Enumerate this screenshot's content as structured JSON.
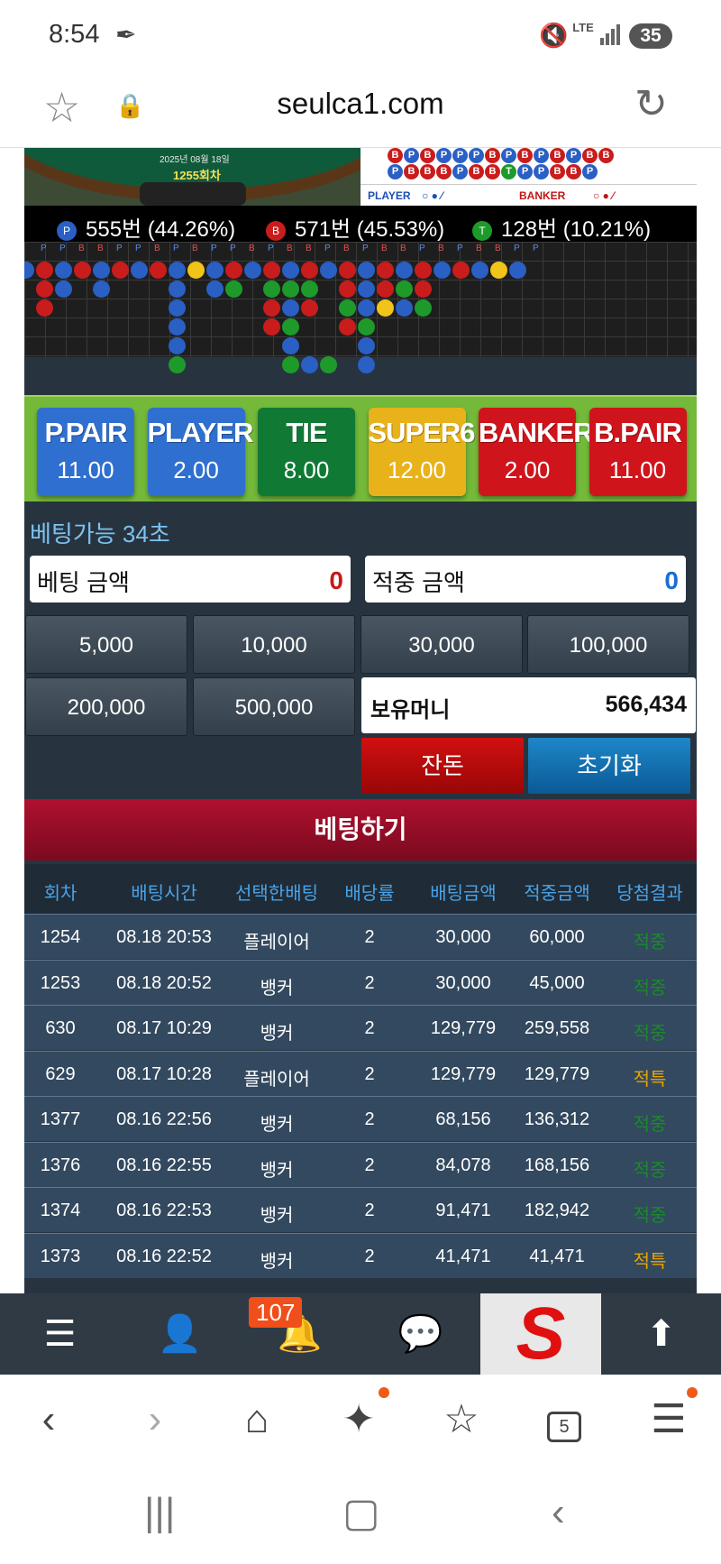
{
  "status_bar": {
    "time": "8:54",
    "network": "LTE",
    "battery": "35"
  },
  "browser": {
    "domain": "seulca1.com"
  },
  "game": {
    "date": "2025년 08월 18일",
    "round": "1255회차",
    "road_top_row1": [
      "B",
      "P",
      "B",
      "P",
      "P",
      "P",
      "B",
      "P",
      "B",
      "P",
      "B",
      "P",
      "B",
      "B"
    ],
    "road_top_row2": [
      "P",
      "B",
      "B",
      "B",
      "P",
      "B",
      "B",
      "T",
      "P",
      "P",
      "B",
      "B",
      "P"
    ],
    "legend_player": "PLAYER",
    "legend_banker": "BANKER",
    "stats": {
      "player": "555번 (44.26%)",
      "banker": "571번 (45.53%)",
      "tie": "128번 (10.21%)",
      "player_mark": "P",
      "banker_mark": "B",
      "tie_mark": "T"
    },
    "big_road_header": [
      "P",
      "P",
      "B",
      "B",
      "P",
      "P",
      "B",
      "P",
      "B",
      "P",
      "P",
      "B",
      "P",
      "B",
      "B",
      "P",
      "B",
      "P",
      "B",
      "B",
      "P",
      "B",
      "P",
      "B",
      "B",
      "P",
      "P"
    ]
  },
  "bet_options": [
    {
      "name": "P.PAIR",
      "odds": "11.00",
      "color": "#2f6fcf"
    },
    {
      "name": "PLAYER",
      "odds": "2.00",
      "color": "#2f6fcf"
    },
    {
      "name": "TIE",
      "odds": "8.00",
      "color": "#107a35"
    },
    {
      "name": "SUPER6",
      "odds": "12.00",
      "color": "#e8b21a"
    },
    {
      "name": "BANKER",
      "odds": "2.00",
      "color": "#d0141c"
    },
    {
      "name": "B.PAIR",
      "odds": "11.00",
      "color": "#d0141c"
    }
  ],
  "betting": {
    "time_label": "베팅가능 34초",
    "bet_amount_label": "베팅 금액",
    "bet_amount_value": "0",
    "win_amount_label": "적중 금액",
    "win_amount_value": "0",
    "chips": [
      "5,000",
      "10,000",
      "30,000",
      "100,000",
      "200,000",
      "500,000"
    ],
    "balance_label": "보유머니",
    "balance_value": "566,434",
    "change_button": "잔돈",
    "reset_button": "초기화",
    "submit_button": "베팅하기"
  },
  "history": {
    "headers": [
      "회차",
      "배팅시간",
      "선택한배팅",
      "배당률",
      "배팅금액",
      "적중금액",
      "당첨결과"
    ],
    "rows": [
      {
        "round": "1254",
        "time": "08.18 20:53",
        "choice": "플레이어",
        "odds": "2",
        "bet": "30,000",
        "win": "60,000",
        "result": "적중"
      },
      {
        "round": "1253",
        "time": "08.18 20:52",
        "choice": "뱅커",
        "odds": "2",
        "bet": "30,000",
        "win": "45,000",
        "result": "적중"
      },
      {
        "round": "630",
        "time": "08.17 10:29",
        "choice": "뱅커",
        "odds": "2",
        "bet": "129,779",
        "win": "259,558",
        "result": "적중"
      },
      {
        "round": "629",
        "time": "08.17 10:28",
        "choice": "플레이어",
        "odds": "2",
        "bet": "129,779",
        "win": "129,779",
        "result": "적특"
      },
      {
        "round": "1377",
        "time": "08.16 22:56",
        "choice": "뱅커",
        "odds": "2",
        "bet": "68,156",
        "win": "136,312",
        "result": "적중"
      },
      {
        "round": "1376",
        "time": "08.16 22:55",
        "choice": "뱅커",
        "odds": "2",
        "bet": "84,078",
        "win": "168,156",
        "result": "적중"
      },
      {
        "round": "1374",
        "time": "08.16 22:53",
        "choice": "뱅커",
        "odds": "2",
        "bet": "91,471",
        "win": "182,942",
        "result": "적중"
      },
      {
        "round": "1373",
        "time": "08.16 22:52",
        "choice": "뱅커",
        "odds": "2",
        "bet": "41,471",
        "win": "41,471",
        "result": "적특"
      }
    ]
  },
  "site_nav": {
    "notification_count": "107",
    "logo_letter": "S"
  },
  "browser_toolbar": {
    "tab_count": "5"
  },
  "colors": {
    "player": "#2a5fc4",
    "banker": "#c91c1c",
    "tie": "#1e9a2a",
    "super6": "#f0c419",
    "hit": "#1a8a2a",
    "miss": "#e8a400"
  }
}
